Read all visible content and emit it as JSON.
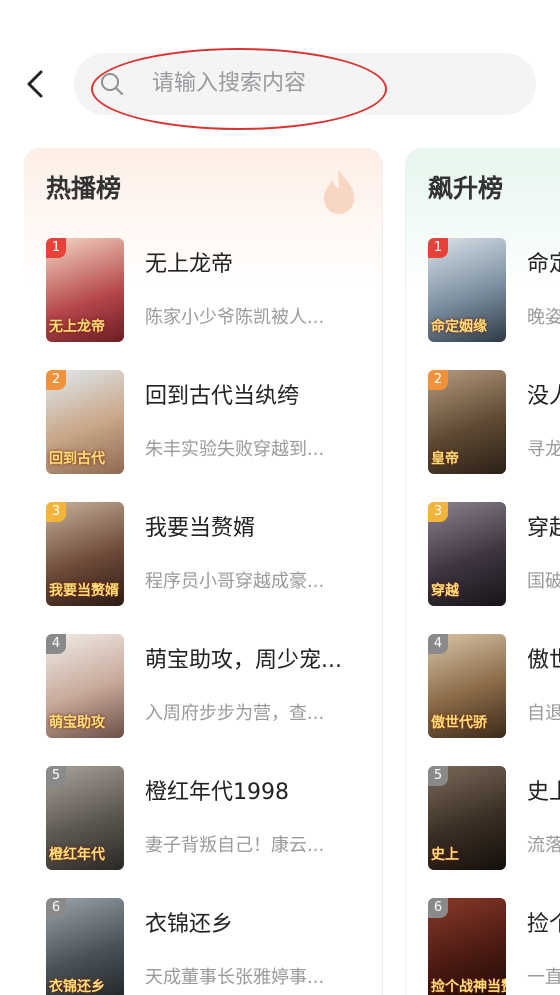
{
  "search": {
    "placeholder": "请输入搜索内容"
  },
  "colors": {
    "highlight": "#d9332f",
    "rank1": "#e8413a",
    "rank2": "#f0913b",
    "rank3": "#f2b43a",
    "rank_other": "#8a8a8a"
  },
  "icons": {
    "back": "chevron-left-icon",
    "search": "search-icon",
    "flame": "flame-icon"
  },
  "hot": {
    "title": "热播榜",
    "items": [
      {
        "rank": "1",
        "title": "无上龙帝",
        "desc": "陈家小少爷陈凯被人...",
        "cover_text": "无上龙帝"
      },
      {
        "rank": "2",
        "title": "回到古代当纨绔",
        "desc": "朱丰实验失败穿越到...",
        "cover_text": "回到古代"
      },
      {
        "rank": "3",
        "title": "我要当赘婿",
        "desc": "程序员小哥穿越成豪...",
        "cover_text": "我要当赘婿"
      },
      {
        "rank": "4",
        "title": "萌宝助攻，周少宠...",
        "desc": "入周府步步为营，查...",
        "cover_text": "萌宝助攻"
      },
      {
        "rank": "5",
        "title": "橙红年代1998",
        "desc": "妻子背叛自己！康云...",
        "cover_text": "橙红年代"
      },
      {
        "rank": "6",
        "title": "衣锦还乡",
        "desc": "天成董事长张雅婷事...",
        "cover_text": "衣锦还乡"
      }
    ]
  },
  "rise": {
    "title": "飙升榜",
    "items": [
      {
        "rank": "1",
        "title": "命定",
        "desc": "晚姿",
        "cover_text": "命定姻缘"
      },
      {
        "rank": "2",
        "title": "没人",
        "desc": "寻龙",
        "cover_text": "皇帝"
      },
      {
        "rank": "3",
        "title": "穿起",
        "desc": "国破",
        "cover_text": "穿越"
      },
      {
        "rank": "4",
        "title": "傲世",
        "desc": "自退",
        "cover_text": "傲世代骄"
      },
      {
        "rank": "5",
        "title": "史上",
        "desc": "流落",
        "cover_text": "史上"
      },
      {
        "rank": "6",
        "title": "捡个",
        "desc": "一直",
        "cover_text": "捡个战神当赘婿"
      }
    ]
  }
}
